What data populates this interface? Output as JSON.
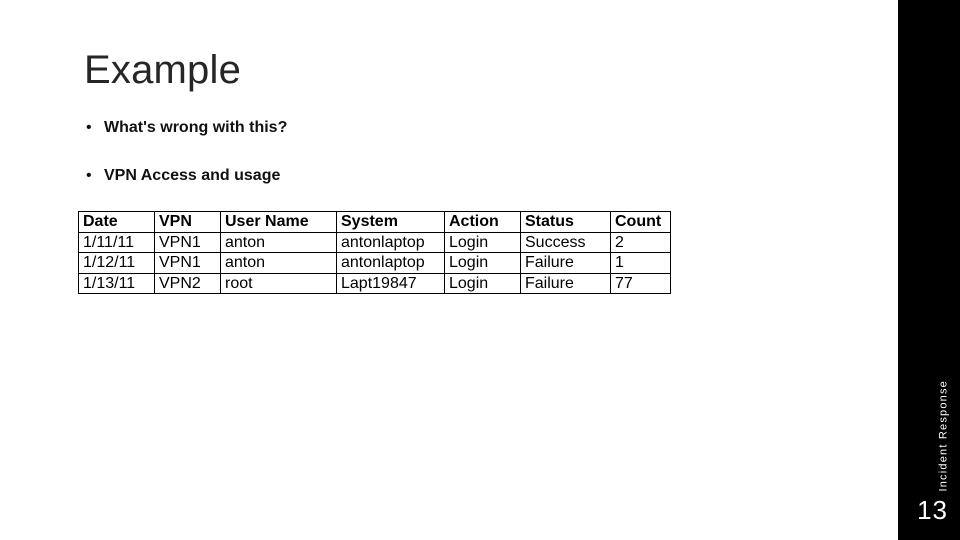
{
  "title": "Example",
  "bullets": [
    "What's wrong with this?",
    "VPN Access and usage"
  ],
  "table": {
    "headers": [
      "Date",
      "VPN",
      "User Name",
      "System",
      "Action",
      "Status",
      "Count"
    ],
    "rows": [
      [
        "1/11/11",
        "VPN1",
        "anton",
        "antonlaptop",
        "Login",
        "Success",
        "2"
      ],
      [
        "1/12/11",
        "VPN1",
        "anton",
        "antonlaptop",
        "Login",
        "Failure",
        "1"
      ],
      [
        "1/13/11",
        "VPN2",
        "root",
        "Lapt19847",
        "Login",
        "Failure",
        "77"
      ]
    ]
  },
  "side_label": "Incident Response",
  "page_number": "13"
}
